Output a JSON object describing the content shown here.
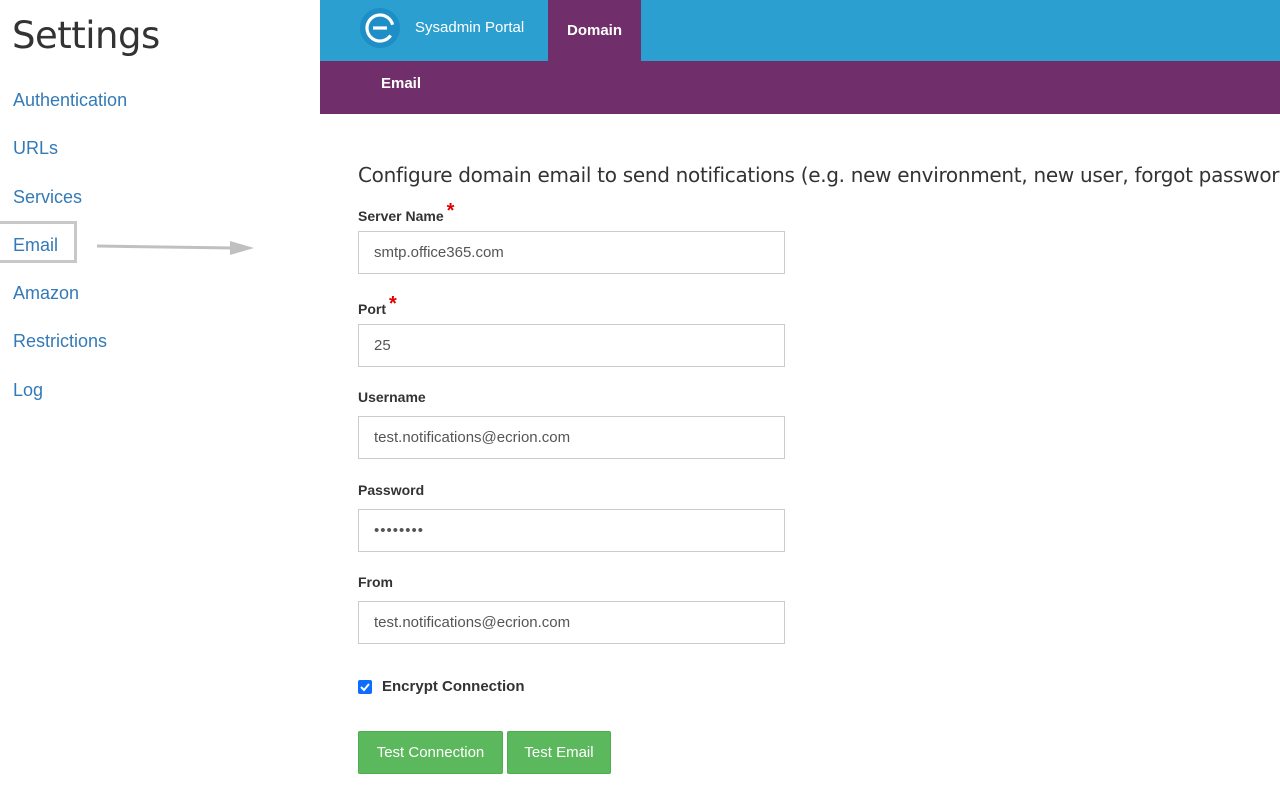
{
  "sidebar": {
    "title": "Settings",
    "items": [
      {
        "label": "Authentication"
      },
      {
        "label": "URLs"
      },
      {
        "label": "Services"
      },
      {
        "label": "Email"
      },
      {
        "label": "Amazon"
      },
      {
        "label": "Restrictions"
      },
      {
        "label": "Log"
      }
    ],
    "highlighted_item": "Email"
  },
  "topbar": {
    "logo_icon": "ecrion-logo-icon",
    "portal_title": "Sysadmin Portal",
    "active_tab": "Domain"
  },
  "subnav": {
    "active_tab": "Email"
  },
  "form": {
    "description": "Configure domain email to send notifications (e.g. new environment, new user, forgot password etc.)",
    "server_name": {
      "label": "Server Name",
      "required": true,
      "value": "smtp.office365.com"
    },
    "port": {
      "label": "Port",
      "required": true,
      "value": "25"
    },
    "username": {
      "label": "Username",
      "value": "test.notifications@ecrion.com"
    },
    "password": {
      "label": "Password",
      "value": "••••••••"
    },
    "from": {
      "label": "From",
      "value": "test.notifications@ecrion.com"
    },
    "encrypt": {
      "label": "Encrypt Connection",
      "checked": true
    },
    "required_marker": "*"
  },
  "buttons": {
    "test_connection": "Test Connection",
    "test_email": "Test Email"
  },
  "colors": {
    "topbar": "#2b9fcf",
    "accent_purple": "#702f6a",
    "link": "#337ab7",
    "button_green": "#5cb85c",
    "required_red": "#e00000"
  }
}
